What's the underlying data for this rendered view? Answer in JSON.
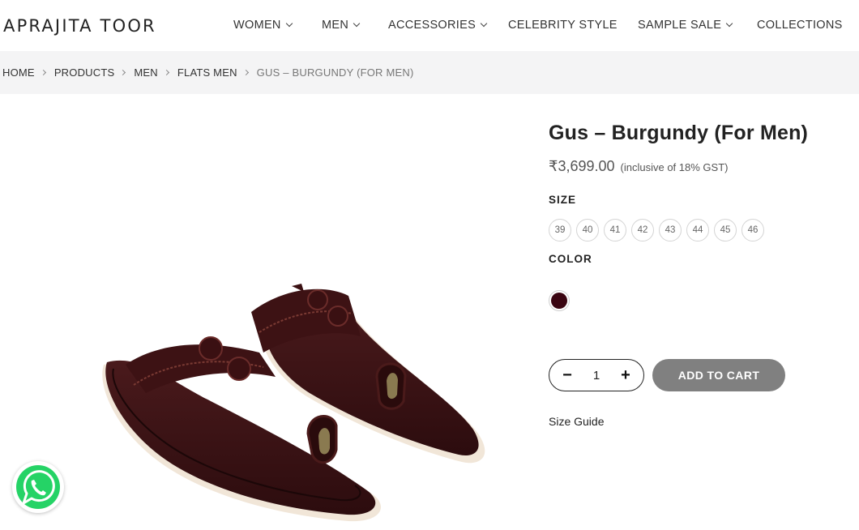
{
  "brand": {
    "logo": "APRAJITA TOOR"
  },
  "nav": [
    {
      "label": "WOMEN",
      "dropdown": true
    },
    {
      "label": "MEN",
      "dropdown": true
    },
    {
      "label": "ACCESSORIES",
      "dropdown": true
    },
    {
      "label": "CELEBRITY STYLE",
      "dropdown": false
    },
    {
      "label": "SAMPLE SALE",
      "dropdown": true
    },
    {
      "label": "COLLECTIONS",
      "dropdown": false
    }
  ],
  "breadcrumb": [
    {
      "label": "HOME"
    },
    {
      "label": "PRODUCTS"
    },
    {
      "label": "MEN"
    },
    {
      "label": "FLATS MEN"
    },
    {
      "label": "GUS – BURGUNDY (FOR MEN)",
      "current": true
    }
  ],
  "product": {
    "title": "Gus – Burgundy (For Men)",
    "price": "₹3,699.00",
    "tax_note": "(inclusive of 18% GST)",
    "image_icon": "burgundy-kolhapuri-sandals-photo"
  },
  "size": {
    "label": "SIZE",
    "options": [
      "39",
      "40",
      "41",
      "42",
      "43",
      "44",
      "45",
      "46"
    ]
  },
  "color": {
    "label": "COLOR",
    "swatch_hex": "#3a0511"
  },
  "cart": {
    "minus": "−",
    "quantity": "1",
    "plus": "+",
    "add_label": "ADD TO CART",
    "button_color": "#808080"
  },
  "size_guide": "Size Guide",
  "whatsapp": {
    "icon": "whatsapp-icon",
    "color": "#25d366"
  }
}
